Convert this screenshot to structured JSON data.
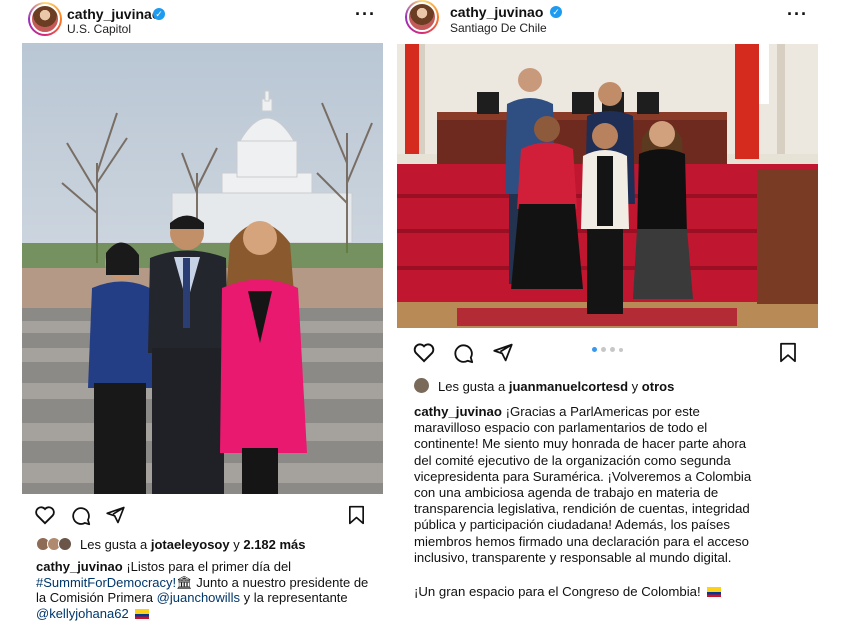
{
  "posts": [
    {
      "username": "cathy_juvinao",
      "location": "U.S. Capitol",
      "likes": {
        "prefix": "Les gusta a",
        "user": "jotaeleyosoy",
        "connector": "y",
        "count": "2.182 más"
      },
      "caption": {
        "author": "cathy_juvinao",
        "line1": "¡Listos para el primer día del",
        "hashtag": "#SummitForDemocracy!",
        "line2_rest": " Junto a nuestro presidente de",
        "line3": "la Comisión Primera",
        "mention1": "@juanchowills",
        "line3_rest": " y la representante",
        "mention2": "@kellyjohana62"
      }
    },
    {
      "username": "cathy_juvinao",
      "location": "Santiago De Chile",
      "likes": {
        "prefix": "Les gusta a",
        "user": "juanmanuelcortesd",
        "connector": "y",
        "count": "otros"
      },
      "caption": {
        "author": "cathy_juvinao",
        "lines": [
          " ¡Gracias a ParlAmericas por este",
          "maravilloso espacio con parlamentarios de todo el",
          "continente! Me siento muy honrada de hacer parte ahora",
          "del comité ejecutivo de la organización como segunda",
          "vicepresidenta para Suramérica. ¡Volveremos a Colombia",
          "con una ambiciosa agenda de trabajo en materia de",
          "transparencia legislativa, rendición de cuentas, integridad",
          "pública y participación ciudadana! Además, los países",
          "miembros hemos firmado una declaración para el acceso",
          "inclusivo, transparente y responsable al mundo digital."
        ],
        "closing": "¡Un gran espacio para el Congreso de Colombia!"
      },
      "carousel": {
        "count": 4,
        "active": 1
      }
    }
  ],
  "icons": [
    "heart-icon",
    "comment-icon",
    "share-icon",
    "bookmark-icon",
    "verified-icon",
    "more-icon",
    "classical-building-icon",
    "colombia-flag-icon"
  ],
  "colors": {
    "verified": "#1d9bf0",
    "link": "#00376b",
    "pink_coat": "#e8196e",
    "carpet": "#c0162f"
  }
}
